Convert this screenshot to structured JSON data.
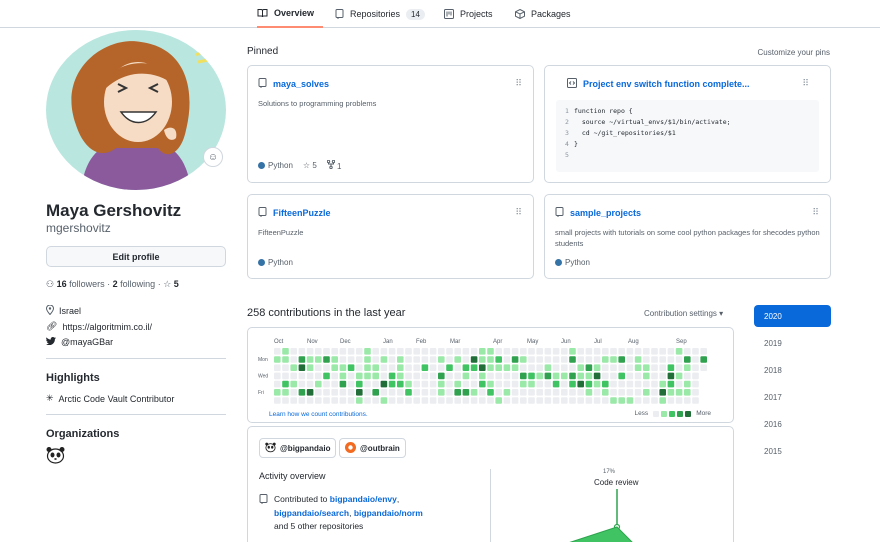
{
  "tabs": [
    {
      "label": "Overview",
      "icon": "book-icon",
      "active": true
    },
    {
      "label": "Repositories",
      "icon": "repo-icon",
      "count": "14"
    },
    {
      "label": "Projects",
      "icon": "project-icon"
    },
    {
      "label": "Packages",
      "icon": "package-icon"
    }
  ],
  "profile": {
    "full_name": "Maya Gershovitz",
    "username": "mgershovitz",
    "edit_label": "Edit profile",
    "followers_count": "16",
    "followers_label": "followers",
    "following_count": "2",
    "following_label": "following",
    "stars_count": "5",
    "location": "Israel",
    "website": "https://algoritmim.co.il/",
    "twitter": "@mayaGBar",
    "highlights_title": "Highlights",
    "highlight_item": "Arctic Code Vault Contributor",
    "orgs_title": "Organizations"
  },
  "pinned": {
    "title": "Pinned",
    "customize": "Customize your pins",
    "cards": [
      {
        "name": "maya_solves",
        "desc": "Solutions to programming problems",
        "lang": "Python",
        "stars": "5",
        "forks": "1"
      },
      {
        "name": "Project env switch function complete...",
        "gist": true
      },
      {
        "name": "FifteenPuzzle",
        "desc": "FifteenPuzzle",
        "lang": "Python"
      },
      {
        "name": "sample_projects",
        "desc": "small projects with tutorials on some cool python packages for shecodes python students",
        "lang": "Python"
      }
    ],
    "gist_lines": [
      {
        "n": "1",
        "code": "function repo {"
      },
      {
        "n": "2",
        "code": "  source ~/virtual_envs/$1/bin/activate;"
      },
      {
        "n": "3",
        "code": "  cd ~/git_repositories/$1"
      },
      {
        "n": "4",
        "code": "}"
      },
      {
        "n": "5",
        "code": ""
      }
    ]
  },
  "contributions": {
    "title": "258 contributions in the last year",
    "settings": "Contribution settings ▾",
    "months": [
      "Oct",
      "Nov",
      "Dec",
      "Jan",
      "Feb",
      "Mar",
      "Apr",
      "May",
      "Jun",
      "Jul",
      "Aug",
      "Sep"
    ],
    "days": [
      "Mon",
      "Wed",
      "Fri"
    ],
    "learn": "Learn how we count contributions.",
    "less": "Less",
    "more": "More",
    "colors": [
      "#ebedf0",
      "#9be9a8",
      "#40c463",
      "#30a14e",
      "#216e39"
    ]
  },
  "years": [
    "2020",
    "2019",
    "2018",
    "2017",
    "2016",
    "2015"
  ],
  "activity": {
    "orgs": [
      "@bigpandaio",
      "@outbrain"
    ],
    "title": "Activity overview",
    "contributed_prefix": "Contributed to",
    "repo1": "bigpandaio/envy",
    "repo2": "bigpandaio/search",
    "repo3": "bigpandaio/norm",
    "other": "and 5 other repositories",
    "code_review_pct": "17%",
    "code_review_label": "Code review"
  }
}
